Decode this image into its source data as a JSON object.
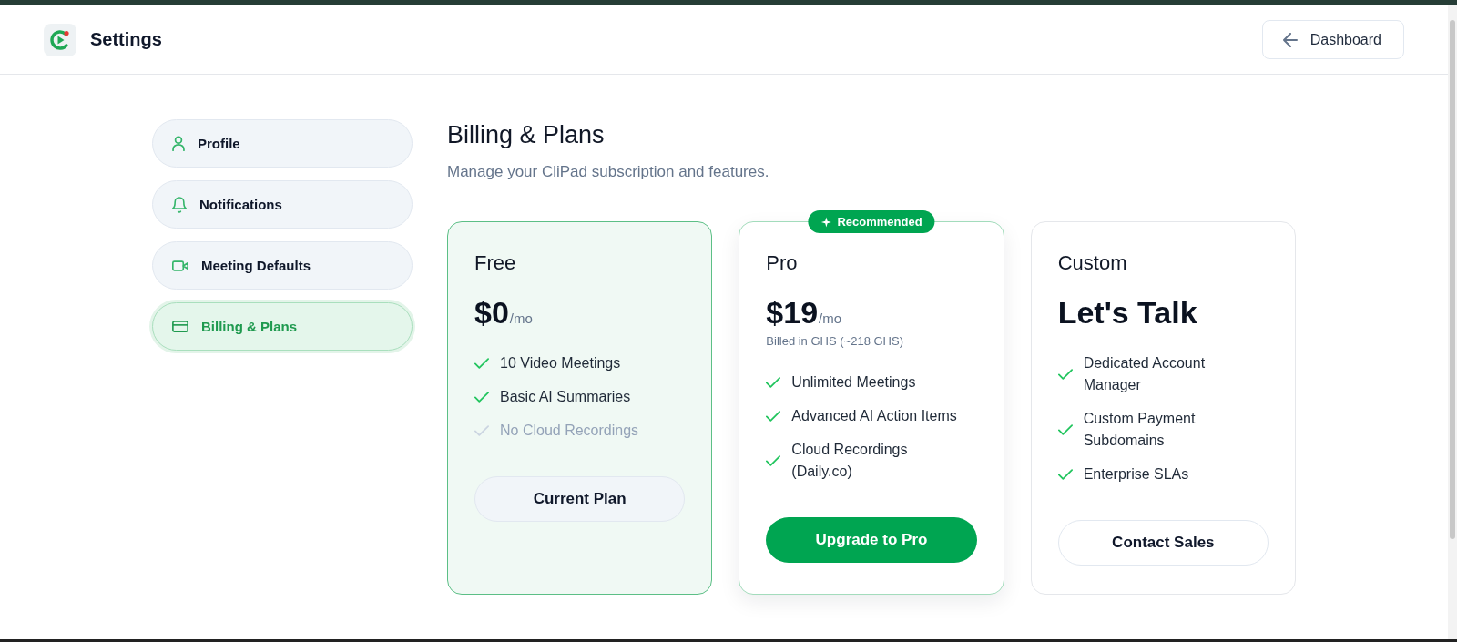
{
  "header": {
    "title": "Settings",
    "back_button": "Dashboard"
  },
  "sidebar": {
    "items": [
      {
        "label": "Profile",
        "selected": false
      },
      {
        "label": "Notifications",
        "selected": false
      },
      {
        "label": "Meeting Defaults",
        "selected": false
      },
      {
        "label": "Billing & Plans",
        "selected": true
      }
    ]
  },
  "page": {
    "title": "Billing & Plans",
    "subtitle": "Manage your CliPad subscription and features."
  },
  "plans": [
    {
      "name": "Free",
      "price": "$0",
      "period": "/mo",
      "current": true,
      "features": [
        {
          "text": "10 Video Meetings",
          "included": true
        },
        {
          "text": "Basic AI Summaries",
          "included": true
        },
        {
          "text": "No Cloud Recordings",
          "included": false
        }
      ],
      "button": {
        "label": "Current Plan",
        "kind": "muted"
      }
    },
    {
      "name": "Pro",
      "badge": "Recommended",
      "price": "$19",
      "period": "/mo",
      "note": "Billed in GHS (~218 GHS)",
      "current": false,
      "features": [
        {
          "text": "Unlimited Meetings",
          "included": true
        },
        {
          "text": "Advanced AI Action Items",
          "included": true
        },
        {
          "text": "Cloud Recordings (Daily.co)",
          "included": true
        }
      ],
      "button": {
        "label": "Upgrade to Pro",
        "kind": "primary"
      }
    },
    {
      "name": "Custom",
      "price": "Let's Talk",
      "current": false,
      "features": [
        {
          "text": "Dedicated Account Manager",
          "included": true
        },
        {
          "text": "Custom Payment Subdomains",
          "included": true
        },
        {
          "text": "Enterprise SLAs",
          "included": true
        }
      ],
      "button": {
        "label": "Contact Sales",
        "kind": "outline"
      }
    }
  ]
}
